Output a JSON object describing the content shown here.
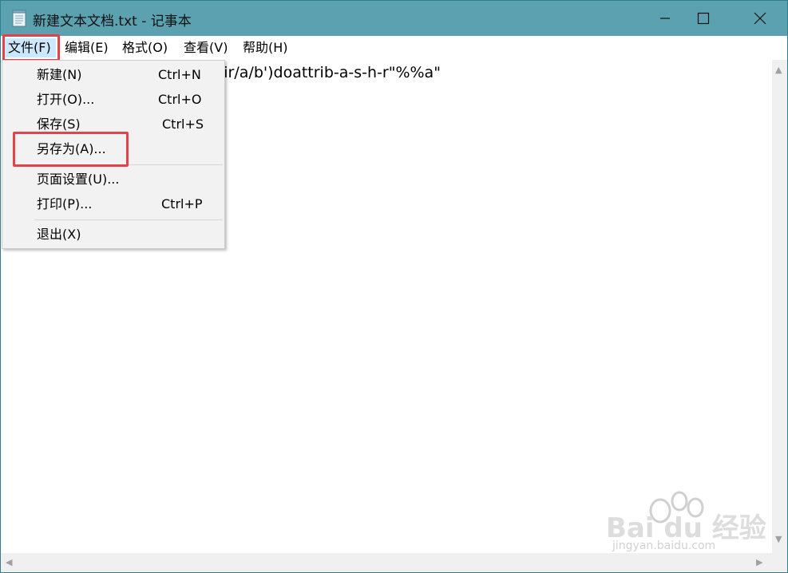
{
  "window": {
    "title": "新建文本文档.txt - 记事本",
    "controls": {
      "minimize": "minimize-icon",
      "maximize": "maximize-icon",
      "close": "close-icon"
    }
  },
  "menubar": {
    "items": [
      {
        "label": "文件(F)",
        "active": true
      },
      {
        "label": "编辑(E)"
      },
      {
        "label": "格式(O)"
      },
      {
        "label": "查看(V)"
      },
      {
        "label": "帮助(H)"
      }
    ]
  },
  "file_menu": {
    "items": [
      {
        "label": "新建(N)",
        "shortcut": "Ctrl+N"
      },
      {
        "label": "打开(O)...",
        "shortcut": "Ctrl+O"
      },
      {
        "label": "保存(S)",
        "shortcut": "Ctrl+S"
      },
      {
        "label": "另存为(A)...",
        "shortcut": ""
      },
      {
        "label": "页面设置(U)...",
        "shortcut": ""
      },
      {
        "label": "打印(P)...",
        "shortcut": "Ctrl+P"
      },
      {
        "label": "退出(X)",
        "shortcut": ""
      }
    ]
  },
  "editor": {
    "visible_text": "lir/a/b')doattrib-a-s-h-r\"%%a\""
  },
  "watermark": {
    "brand": "Bai du 经验",
    "url": "jingyan.baidu.com"
  },
  "colors": {
    "titlebar": "#5ba1b0",
    "highlight": "#e2434b",
    "menu_active": "#cce8ff",
    "menu_bg": "#f2f2f2"
  }
}
